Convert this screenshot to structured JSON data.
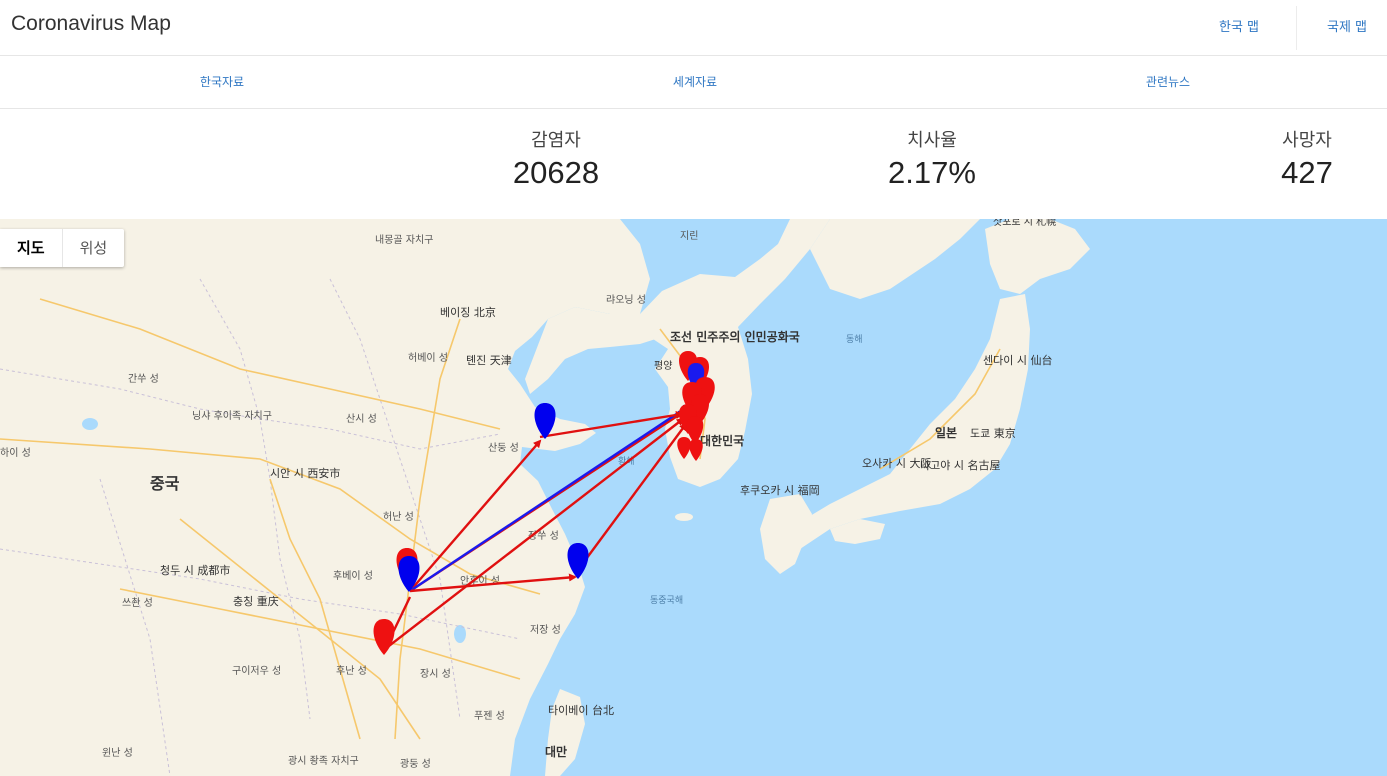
{
  "header": {
    "title": "Coronavirus Map",
    "links": [
      "한국 맵",
      "국제 맵"
    ]
  },
  "subnav": {
    "items": [
      "한국자료",
      "세계자료",
      "관련뉴스"
    ]
  },
  "stats": [
    {
      "label": "감염자",
      "value": "20628"
    },
    {
      "label": "치사율",
      "value": "2.17%"
    },
    {
      "label": "사망자",
      "value": "427"
    }
  ],
  "map": {
    "type_buttons": [
      "지도",
      "위성"
    ],
    "labels": {
      "inner_mongolia": "내몽골 자치구",
      "jilin": "지린",
      "liaoning": "랴오닝 성",
      "beijing": "베이징 北京",
      "tianjin": "톈진 天津",
      "hebei": "허베이 성",
      "shanxi": "산시 성",
      "shandong": "산둥 성",
      "gansu": "간쑤 성",
      "ningxia": "닝샤 후이족 자치구",
      "shaanxi_west": "하이 성",
      "china": "중국",
      "xian": "시안 시 西安市",
      "henan": "허난 성",
      "jiangsu": "장쑤 성",
      "chengdu": "청두 시 成都市",
      "hubei": "후베이 성",
      "anhui": "안후이 성",
      "sichuan": "쓰촨 성",
      "chongqing": "충칭 重庆",
      "zhejiang": "저장 성",
      "guizhou": "구이저우 성",
      "hunan": "후난 성",
      "jiangxi": "장시 성",
      "fujian": "푸젠 성",
      "taipei": "타이베이 台北",
      "taiwan": "대만",
      "yunnan": "윈난 성",
      "guangxi": "광시 좡족 자치구",
      "guangdong": "광둥 성",
      "east_china_sea": "동중국해",
      "yellow_sea": "황해",
      "east_sea": "동해",
      "dprk": "조선 민주주의 인민공화국",
      "pyongyang": "평양",
      "rok": "대한민국",
      "japan": "일본",
      "tokyo": "도쿄 東京",
      "sendai": "센다이 시 仙台",
      "osaka": "오사카 시 大阪",
      "nagoya": "나고야 시 名古屋",
      "fukuoka": "후쿠오카 시 福岡",
      "sapporo": "삿포로 시 札幌"
    }
  },
  "colors": {
    "link": "#2f77c3",
    "sea": "#aadafc",
    "land": "#f6f2e6",
    "marker_red": "#ee1111",
    "marker_blue": "#0000ee",
    "arrow_red": "#e01010",
    "arrow_blue": "#1a1aee"
  }
}
